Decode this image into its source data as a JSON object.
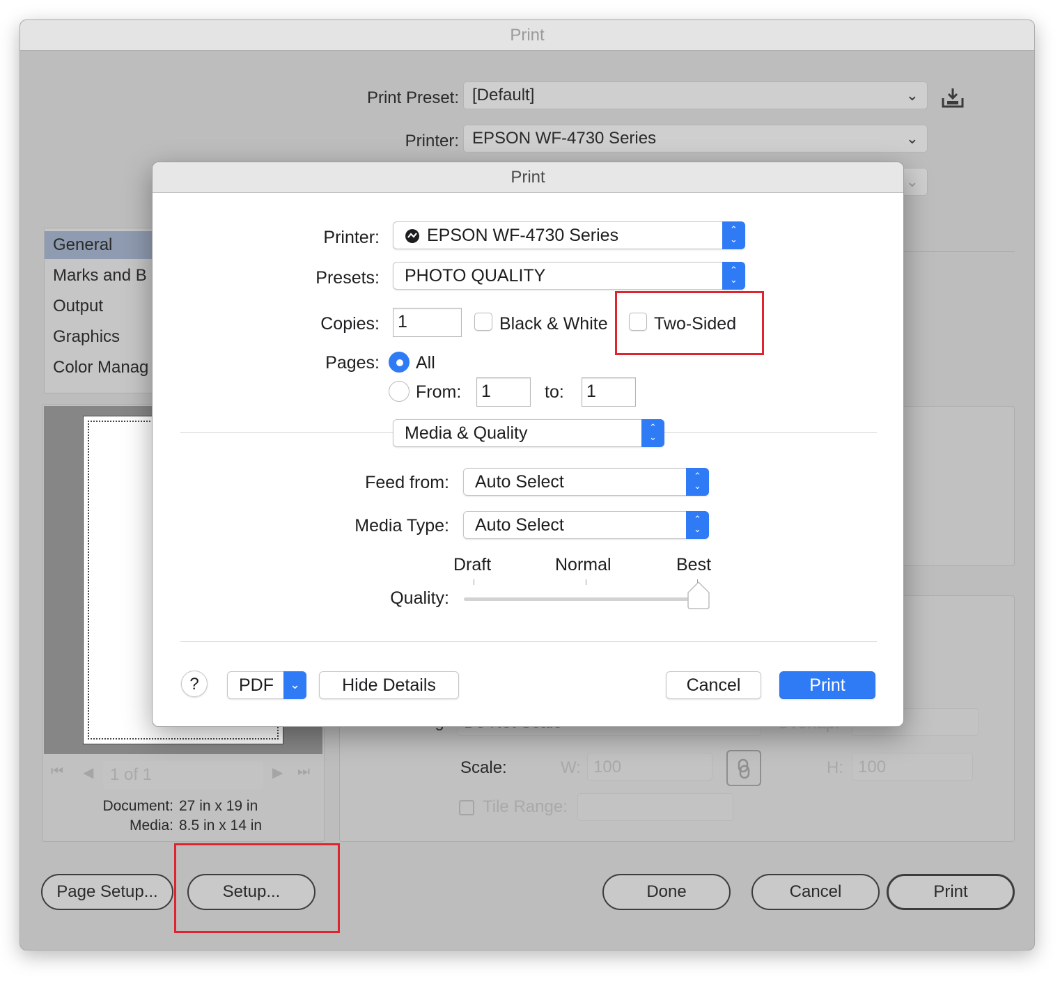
{
  "outer_dialog": {
    "title": "Print",
    "print_preset_label": "Print Preset:",
    "print_preset_value": "[Default]",
    "printer_label": "Printer:",
    "printer_value": "EPSON WF-4730 Series",
    "sidebar": {
      "items": [
        {
          "label": "General",
          "selected": true
        },
        {
          "label": "Marks and B",
          "selected": false
        },
        {
          "label": "Output",
          "selected": false
        },
        {
          "label": "Graphics",
          "selected": false
        },
        {
          "label": "Color Manag",
          "selected": false
        }
      ]
    },
    "preview": {
      "page_indicator": "1 of 1",
      "document_label": "Document:",
      "document_value": "27 in x 19 in",
      "media_label": "Media:",
      "media_value": "8.5 in x 14 in"
    },
    "options": {
      "scaling_label": "Scaling:",
      "scaling_value": "Do Not Scale",
      "overlap_label": "Overlap:",
      "scale_label": "Scale:",
      "w_label": "W:",
      "w_value": "100",
      "h_label": "H:",
      "h_value": "100",
      "tile_range_label": "Tile Range:"
    },
    "buttons": {
      "page_setup": "Page Setup...",
      "setup": "Setup...",
      "done": "Done",
      "cancel": "Cancel",
      "print": "Print"
    }
  },
  "print_sheet": {
    "title": "Print",
    "printer_label": "Printer:",
    "printer_value": "EPSON WF-4730 Series",
    "presets_label": "Presets:",
    "presets_value": "PHOTO QUALITY",
    "copies_label": "Copies:",
    "copies_value": "1",
    "black_white_label": "Black & White",
    "black_white_checked": false,
    "two_sided_label": "Two-Sided",
    "two_sided_checked": false,
    "pages_label": "Pages:",
    "pages_all_label": "All",
    "pages_from_label": "From:",
    "pages_from_value": "1",
    "pages_to_label": "to:",
    "pages_to_value": "1",
    "section_value": "Media & Quality",
    "feed_from_label": "Feed from:",
    "feed_from_value": "Auto Select",
    "media_type_label": "Media Type:",
    "media_type_value": "Auto Select",
    "quality_label": "Quality:",
    "quality_levels": [
      "Draft",
      "Normal",
      "Best"
    ],
    "quality_value": "Best",
    "help_label": "?",
    "pdf_label": "PDF",
    "hide_details_label": "Hide Details",
    "cancel_label": "Cancel",
    "print_label": "Print"
  },
  "colors": {
    "accent": "#2f7bf5",
    "highlight": "#e0242d"
  }
}
